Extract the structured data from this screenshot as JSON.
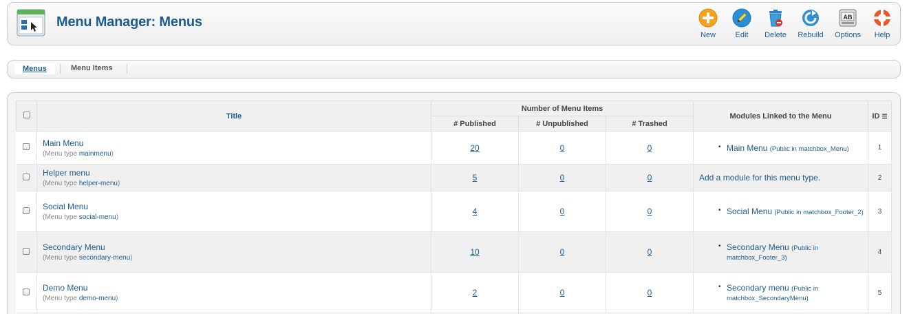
{
  "toolbar": {
    "title": "Menu Manager: Menus",
    "page_icon": "menu-manager-icon",
    "buttons": [
      {
        "label": "New",
        "icon": "new-icon"
      },
      {
        "label": "Edit",
        "icon": "edit-icon"
      },
      {
        "label": "Delete",
        "icon": "delete-icon"
      },
      {
        "label": "Rebuild",
        "icon": "rebuild-icon"
      },
      {
        "label": "Options",
        "icon": "options-icon"
      },
      {
        "label": "Help",
        "icon": "help-icon"
      }
    ]
  },
  "subnav": {
    "tabs": [
      {
        "label": "Menus",
        "active": true
      },
      {
        "label": "Menu Items",
        "active": false
      }
    ]
  },
  "table": {
    "headers": {
      "title": "Title",
      "number_group": "Number of Menu Items",
      "published": "# Published",
      "unpublished": "# Unpublished",
      "trashed": "# Trashed",
      "modules": "Modules Linked to the Menu",
      "id": "ID"
    },
    "type_prefix": "(Menu type ",
    "type_suffix": ")",
    "rows": [
      {
        "title": "Main Menu",
        "type": "mainmenu",
        "published": "20",
        "unpublished": "0",
        "trashed": "0",
        "module_name": "Main Menu",
        "module_pos": "(Public in matchbox_Menu)",
        "id": "1"
      },
      {
        "title": "Helper menu",
        "type": "helper-menu",
        "published": "5",
        "unpublished": "0",
        "trashed": "0",
        "add_module": "Add a module for this menu type.",
        "id": "2"
      },
      {
        "title": "Social Menu",
        "type": "social-menu",
        "published": "4",
        "unpublished": "0",
        "trashed": "0",
        "module_name": "Social Menu",
        "module_pos": "(Public in matchbox_Footer_2)",
        "id": "3"
      },
      {
        "title": "Secondary Menu",
        "type": "secondary-menu",
        "published": "10",
        "unpublished": "0",
        "trashed": "0",
        "module_name": "Secondary Menu",
        "module_pos": "(Public in matchbox_Footer_3)",
        "id": "4"
      },
      {
        "title": "Demo Menu",
        "type": "demo-menu",
        "published": "2",
        "unpublished": "0",
        "trashed": "0",
        "module_name": "Secondary menu",
        "module_pos": "(Public in matchbox_SecondaryMenu)",
        "id": "5"
      }
    ]
  },
  "colors": {
    "accent": "#1d5c8f",
    "new": "#f7a21b",
    "edit": "#2a8fd6",
    "delete": "#3b9fd9",
    "help": "#e8592a"
  }
}
